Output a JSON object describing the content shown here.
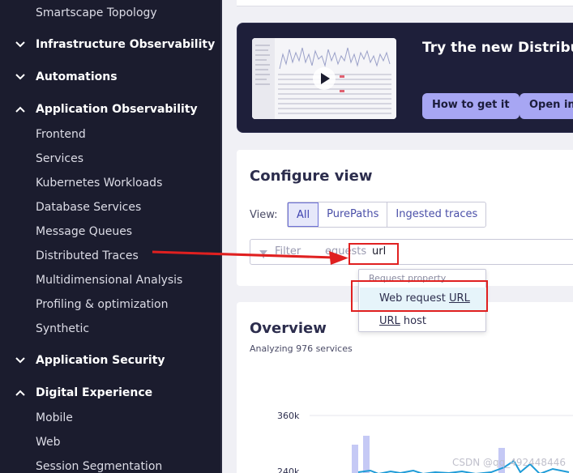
{
  "sidebar": {
    "items": [
      {
        "type": "sub",
        "label": "Smartscape Topology"
      },
      {
        "type": "group",
        "label": "Infrastructure Observability",
        "expanded": false
      },
      {
        "type": "group",
        "label": "Automations",
        "expanded": false
      },
      {
        "type": "group",
        "label": "Application Observability",
        "expanded": true
      },
      {
        "type": "sub",
        "label": "Frontend"
      },
      {
        "type": "sub",
        "label": "Services"
      },
      {
        "type": "sub",
        "label": "Kubernetes Workloads"
      },
      {
        "type": "sub",
        "label": "Database Services"
      },
      {
        "type": "sub",
        "label": "Message Queues"
      },
      {
        "type": "sub",
        "label": "Distributed Traces"
      },
      {
        "type": "sub",
        "label": "Multidimensional Analysis"
      },
      {
        "type": "sub",
        "label": "Profiling & optimization"
      },
      {
        "type": "sub",
        "label": "Synthetic"
      },
      {
        "type": "group",
        "label": "Application Security",
        "expanded": false
      },
      {
        "type": "group",
        "label": "Digital Experience",
        "expanded": true
      },
      {
        "type": "sub",
        "label": "Mobile"
      },
      {
        "type": "sub",
        "label": "Web"
      },
      {
        "type": "sub",
        "label": "Session Segmentation"
      }
    ]
  },
  "promo": {
    "title": "Try the new Distribute",
    "how_button": "How to get it",
    "open_button": "Open in"
  },
  "configure": {
    "title": "Configure view",
    "view_label": "View:",
    "segments": [
      "All",
      "PurePaths",
      "Ingested traces"
    ],
    "active_segment": "All",
    "filter_placeholder_left": "Filter",
    "filter_placeholder_right": "equests",
    "filter_value": "url"
  },
  "dropdown": {
    "header": "Request property",
    "items": [
      {
        "prefix": "Web request ",
        "match": "URL",
        "suffix": ""
      },
      {
        "prefix": "",
        "match": "URL",
        "suffix": " host"
      }
    ]
  },
  "overview": {
    "title": "Overview",
    "subtitle": "Analyzing 976 services",
    "y_ticks": [
      "360k",
      "240k"
    ]
  },
  "watermark": "CSDN @qq_492448446",
  "colors": {
    "sidebar_bg": "#1b1c2e",
    "promo_bg": "#1e1f3a",
    "promo_button": "#a7a6f3",
    "annotation_red": "#e02020",
    "chart_bar": "#c5c9f5",
    "chart_line": "#1e9bd7"
  }
}
